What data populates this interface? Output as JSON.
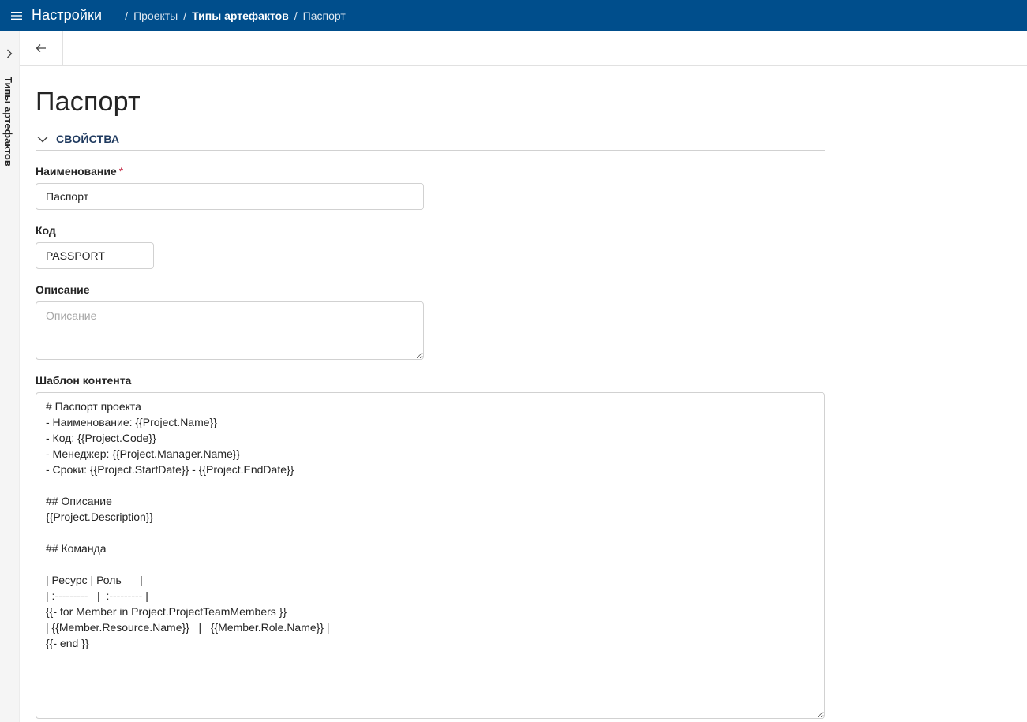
{
  "header": {
    "app_title": "Настройки",
    "breadcrumb": [
      {
        "label": "Проекты"
      },
      {
        "label": "Типы артефактов"
      },
      {
        "label": "Паспорт"
      }
    ],
    "separator": "/"
  },
  "rail": {
    "label": "Типы артефактов"
  },
  "page": {
    "title": "Паспорт"
  },
  "section": {
    "title": "СВОЙСТВА"
  },
  "form": {
    "name": {
      "label": "Наименование",
      "required_mark": "*",
      "value": "Паспорт"
    },
    "code": {
      "label": "Код",
      "value": "PASSPORT"
    },
    "description": {
      "label": "Описание",
      "placeholder": "Описание",
      "value": ""
    },
    "template": {
      "label": "Шаблон контента",
      "value": "# Паспорт проекта\n- Наименование: {{Project.Name}}\n- Код: {{Project.Code}}\n- Менеджер: {{Project.Manager.Name}}\n- Сроки: {{Project.StartDate}} - {{Project.EndDate}}\n\n## Описание\n{{Project.Description}}\n\n## Команда\n\n| Ресурс | Роль      |\n| :---------   |  :--------- |\n{{- for Member in Project.ProjectTeamMembers }}\n| {{Member.Resource.Name}}   |   {{Member.Role.Name}} |\n{{- end }}"
    }
  },
  "colors": {
    "header_bg": "#004e8c",
    "required": "#c4314b"
  }
}
